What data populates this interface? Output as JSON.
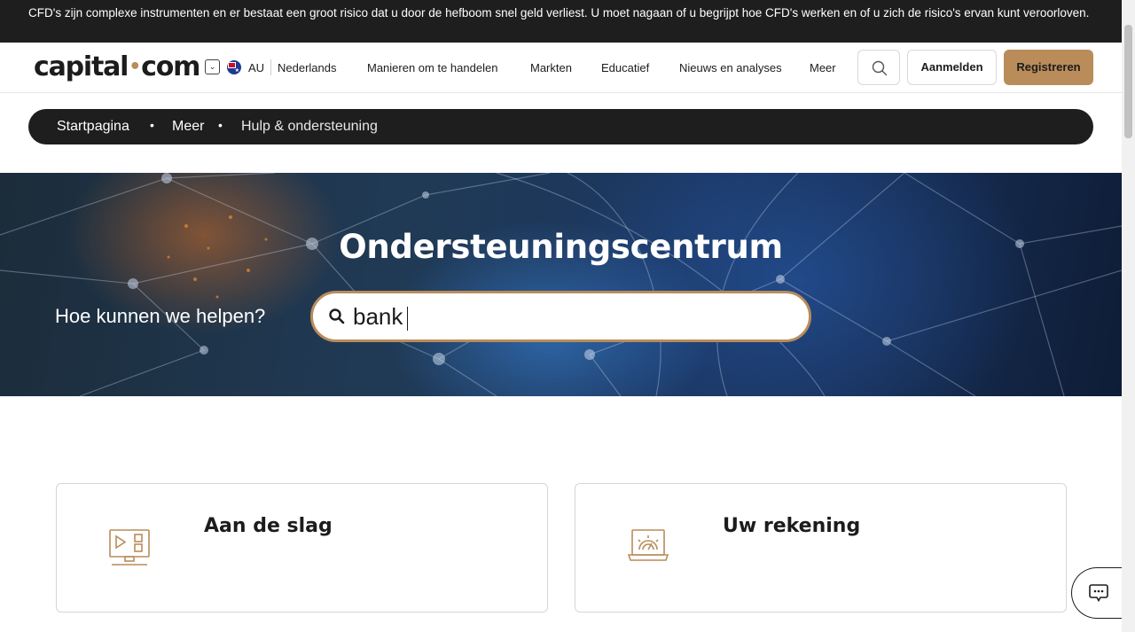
{
  "risk_banner": {
    "text": "CFD's zijn complexe instrumenten en er bestaat een groot risico dat u door de hefboom snel geld verliest. U moet nagaan of u begrijpt hoe CFD's werken en of u zich de risico's ervan kunt veroorloven."
  },
  "header": {
    "logo_left": "capital",
    "logo_dot": "•",
    "logo_right": "com",
    "region_code": "AU",
    "language": "Nederlands",
    "nav": [
      "Manieren om te handelen",
      "Markten",
      "Educatief",
      "Nieuws en analyses",
      "Meer"
    ],
    "login_label": "Aanmelden",
    "register_label": "Registreren"
  },
  "breadcrumb": {
    "items": [
      "Startpagina",
      "Meer",
      "Hulp & ondersteuning"
    ],
    "separator": "•"
  },
  "hero": {
    "title": "Ondersteuningscentrum",
    "prompt": "Hoe kunnen we helpen?",
    "search_value": "bank"
  },
  "cards": [
    {
      "title": "Aan de slag",
      "icon": "monitor-play-icon"
    },
    {
      "title": "Uw rekening",
      "icon": "laptop-gauge-icon"
    }
  ],
  "colors": {
    "accent": "#b98c5a",
    "dark": "#1e1e1e"
  }
}
